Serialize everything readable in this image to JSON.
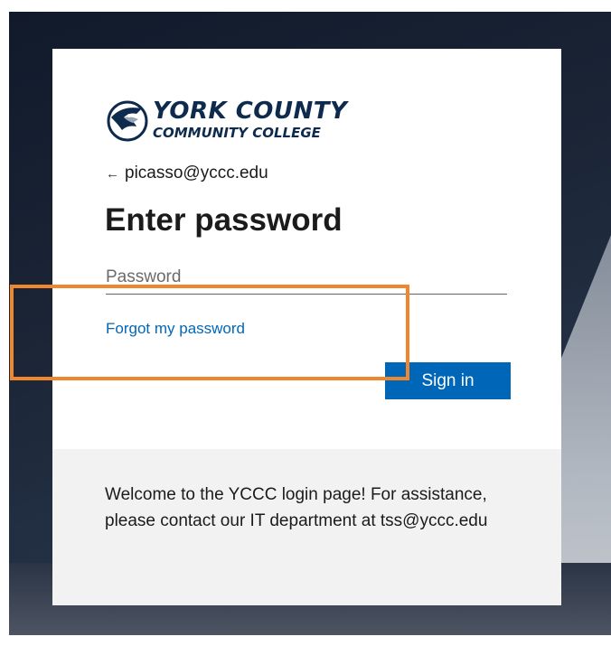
{
  "branding": {
    "line1": "YORK COUNTY",
    "line2": "COMMUNITY COLLEGE",
    "primary_color": "#0e2a4d"
  },
  "identity": {
    "back_icon": "left-arrow-icon",
    "email": "picasso@yccc.edu"
  },
  "page_title": "Enter password",
  "password_field": {
    "placeholder": "Password",
    "value": ""
  },
  "forgot_link": "Forgot my password",
  "signin_button": "Sign in",
  "footer": {
    "message": "Welcome to the YCCC login page! For assistance, please contact our IT department at tss@yccc.edu"
  },
  "colors": {
    "accent": "#0067b8",
    "highlight": "#f0862d",
    "footer_bg": "#f2f2f2"
  }
}
